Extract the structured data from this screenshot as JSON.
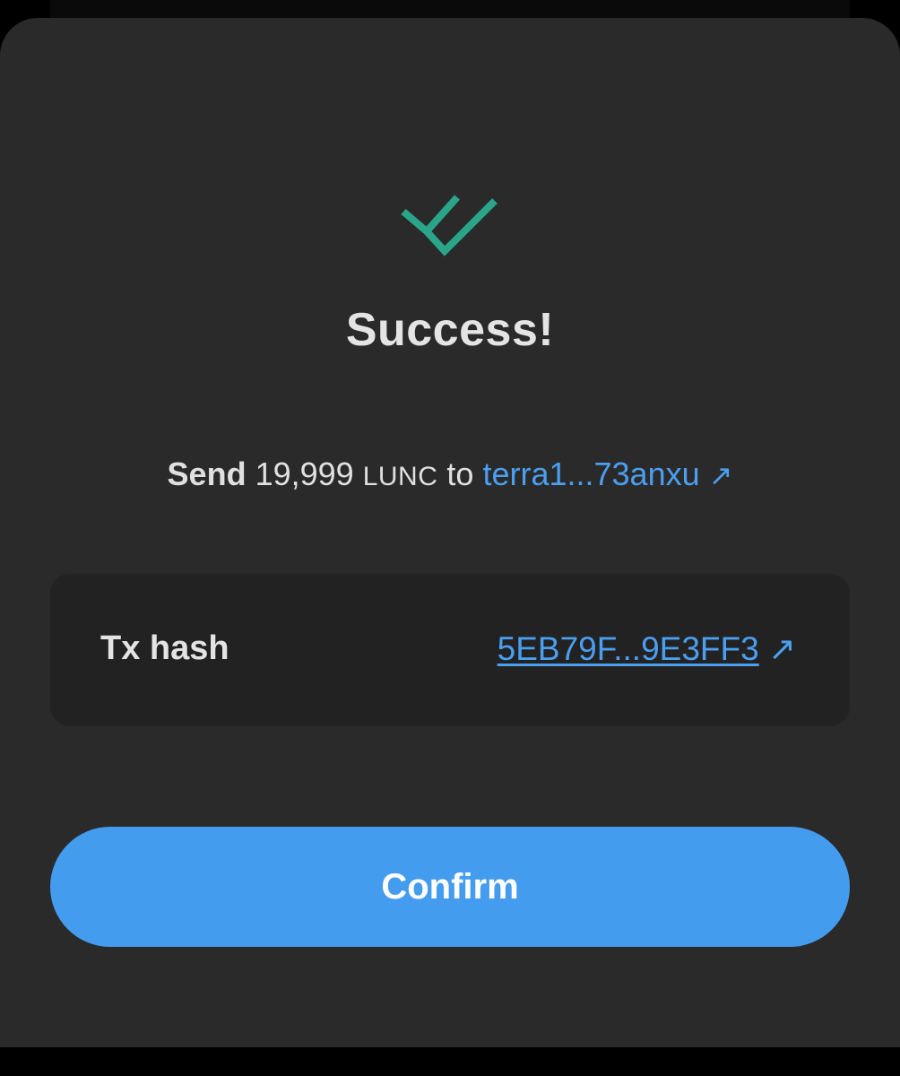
{
  "dialog": {
    "title": "Success!",
    "summary": {
      "verb": "Send",
      "amount": "19,999",
      "denom": "LUNC",
      "preposition": "to",
      "recipient": "terra1...73anxu",
      "external_icon": "↗"
    },
    "details": {
      "tx_hash_label": "Tx hash",
      "tx_hash_value": "5EB79F...9E3FF3",
      "external_icon": "↗"
    },
    "confirm_label": "Confirm"
  },
  "icons": {
    "success": "double-check-icon",
    "external": "external-link-icon"
  },
  "colors": {
    "background": "#2a2a2a",
    "card": "#222222",
    "accent": "#449cef",
    "link": "#4b9ff0",
    "success": "#2aa58a",
    "text": "#e4e4e4"
  }
}
